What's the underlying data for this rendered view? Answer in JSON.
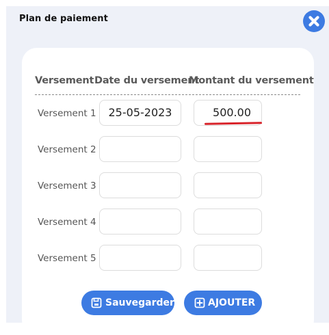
{
  "modal": {
    "title": "Plan de paiement",
    "close_icon": "close-x-circle-icon",
    "accent_color": "#3d7be2"
  },
  "table": {
    "headers": [
      "Versement",
      "Date du versement",
      "Montant du versement"
    ],
    "rows": [
      {
        "label": "Versement 1",
        "date": "25-05-2023",
        "amount": "500.00"
      },
      {
        "label": "Versement 2",
        "date": "",
        "amount": ""
      },
      {
        "label": "Versement 3",
        "date": "",
        "amount": ""
      },
      {
        "label": "Versement 4",
        "date": "",
        "amount": ""
      },
      {
        "label": "Versement 5",
        "date": "",
        "amount": ""
      }
    ]
  },
  "annotation": {
    "underline_color": "#d8232a"
  },
  "buttons": {
    "save_label": "Sauvegarder",
    "save_icon": "floppy-disk-icon",
    "add_label": "AJOUTER",
    "add_icon": "plus-square-icon"
  }
}
